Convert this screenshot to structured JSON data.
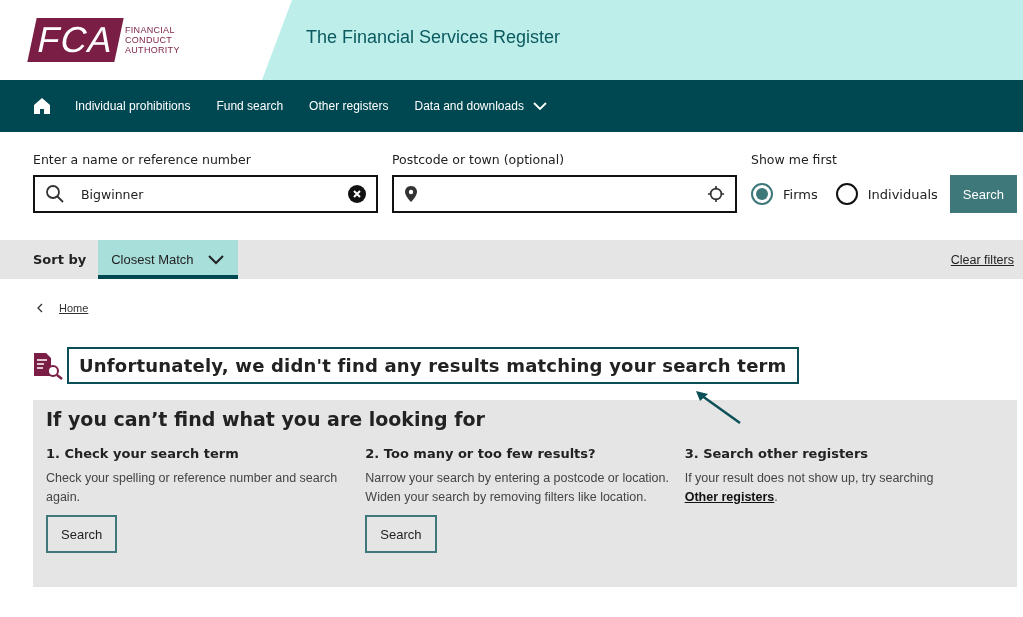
{
  "logo": {
    "letters": "FCA",
    "words": [
      "FINANCIAL",
      "CONDUCT",
      "AUTHORITY"
    ]
  },
  "header": {
    "title": "The Financial Services Register"
  },
  "nav": {
    "items": [
      {
        "label": "Individual prohibitions",
        "kind": "link"
      },
      {
        "label": "Fund search",
        "kind": "link"
      },
      {
        "label": "Other registers",
        "kind": "link"
      },
      {
        "label": "Data and downloads",
        "kind": "dropdown"
      }
    ]
  },
  "search": {
    "name_label": "Enter a name or reference number",
    "name_value": "Bigwinner",
    "location_label": "Postcode or town (optional)",
    "show_label": "Show me first",
    "options": [
      {
        "label": "Firms",
        "selected": true
      },
      {
        "label": "Individuals",
        "selected": false
      }
    ],
    "button": "Search"
  },
  "sort": {
    "label": "Sort by",
    "value": "Closest Match",
    "clear": "Clear filters"
  },
  "breadcrumb": {
    "items": [
      "Home"
    ]
  },
  "result": {
    "message": "Unfortunately, we didn't find any results matching your search term"
  },
  "help": {
    "title": "If you can’t find what you are looking for",
    "columns": [
      {
        "heading": "1. Check your search term",
        "lines": [
          "Check your spelling or reference number and search again."
        ],
        "button": "Search"
      },
      {
        "heading": "2. Too many or too few results?",
        "lines": [
          "Narrow your search by entering a postcode or location.",
          "Widen your search by removing filters like location."
        ],
        "button": "Search"
      },
      {
        "heading": "3. Search other registers",
        "lines": [
          "If your result does not show up, try searching"
        ],
        "link": "Other registers",
        "after": "."
      }
    ]
  }
}
